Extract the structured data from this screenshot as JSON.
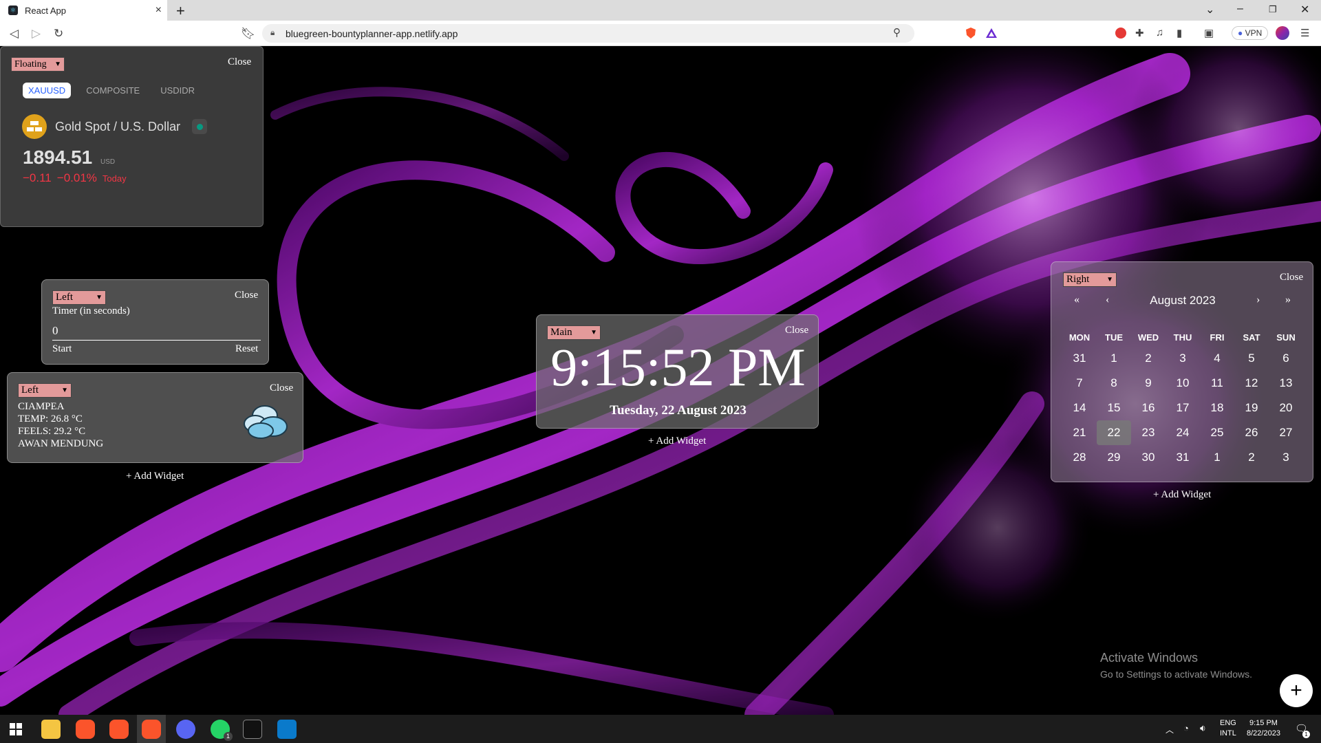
{
  "browser": {
    "tab_title": "React App",
    "tab_close": "×",
    "new_tab": "+",
    "url": "bluegreen-bountyplanner-app.netlify.app",
    "vpn_label": "VPN",
    "win_min": "–",
    "win_max": "❐",
    "win_close": "✕",
    "tab_dropdown": "⌄"
  },
  "gold_widget": {
    "position_select": "Floating",
    "close": "Close",
    "tabs": [
      "XAUUSD",
      "COMPOSITE",
      "USDIDR"
    ],
    "active_tab": "XAUUSD",
    "symbol_name": "Gold Spot / U.S. Dollar",
    "price": "1894.51",
    "currency": "USD",
    "change": "−0.11",
    "change_pct": "−0.01%",
    "period": "Today"
  },
  "timer_widget": {
    "position_select": "Left",
    "close": "Close",
    "title": "Timer (in seconds)",
    "value": "0",
    "start": "Start",
    "reset": "Reset"
  },
  "weather_widget": {
    "position_select": "Left",
    "close": "Close",
    "city": "CIAMPEA",
    "temp": "TEMP: 26.8 °C",
    "feels": "FEELS: 29.2 °C",
    "condition": "AWAN MENDUNG"
  },
  "left_column": {
    "add_widget": "+ Add Widget"
  },
  "clock_widget": {
    "position_select": "Main",
    "close": "Close",
    "time": "9:15:52 PM",
    "date": "Tuesday, 22 August 2023",
    "add_widget": "+ Add Widget"
  },
  "calendar_widget": {
    "position_select": "Right",
    "close": "Close",
    "month_label": "August 2023",
    "nav_prev_year": "«",
    "nav_prev": "‹",
    "nav_next": "›",
    "nav_next_year": "»",
    "weekdays": [
      "MON",
      "TUE",
      "WED",
      "THU",
      "FRI",
      "SAT",
      "SUN"
    ],
    "weeks": [
      [
        "31",
        "1",
        "2",
        "3",
        "4",
        "5",
        "6"
      ],
      [
        "7",
        "8",
        "9",
        "10",
        "11",
        "12",
        "13"
      ],
      [
        "14",
        "15",
        "16",
        "17",
        "18",
        "19",
        "20"
      ],
      [
        "21",
        "22",
        "23",
        "24",
        "25",
        "26",
        "27"
      ],
      [
        "28",
        "29",
        "30",
        "31",
        "1",
        "2",
        "3"
      ]
    ],
    "selected_day": "22",
    "add_widget": "+ Add Widget"
  },
  "watermark": {
    "line1": "Activate Windows",
    "line2": "Go to Settings to activate Windows."
  },
  "fab": "+",
  "taskbar": {
    "lang1": "ENG",
    "lang2": "INTL",
    "time": "9:15 PM",
    "date": "8/22/2023",
    "notif_count": "1",
    "whatsapp_badge": "1"
  },
  "colors": {
    "accent_purple": "#b01ad6",
    "change_red": "#f23645",
    "active_tab_blue": "#2962ff",
    "select_pink": "#e39a9a",
    "gold_icon": "#e0a21b",
    "status_green": "#089981"
  }
}
